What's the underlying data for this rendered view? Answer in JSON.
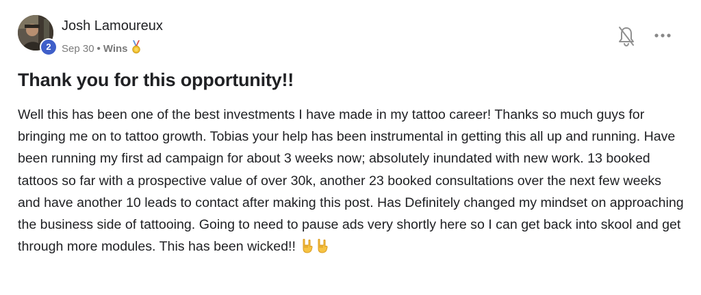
{
  "author": {
    "name": "Josh Lamoureux",
    "level": "2"
  },
  "meta": {
    "date": "Sep 30",
    "separator": "•",
    "category": "Wins"
  },
  "icons": {
    "medal": "medal-icon",
    "bell": "bell-off-icon",
    "more": "more-horizontal-icon",
    "emoji": "rock-on-hand-emoji"
  },
  "post": {
    "title": "Thank you for this opportunity!!",
    "body": "Well this has been one of the best investments I have made in my tattoo career! Thanks so much guys for bringing me on to tattoo growth. Tobias your help has been instrumental in getting this all up and running. Have been running my first ad campaign for about 3 weeks now; absolutely inundated with new work. 13 booked tattoos so far with a prospective value of over 30k, another 23 booked consultations over the next few weeks and have another 10 leads to contact after making this post. Has Definitely changed my mindset on approaching the business side of tattooing. Going to need to pause ads very shortly here so I can get back into skool and get through more modules. This has been wicked!!"
  },
  "colors": {
    "level_badge": "#3f5fc9",
    "meta_text": "#7a7a7a",
    "text": "#202124",
    "icon": "#909090"
  }
}
